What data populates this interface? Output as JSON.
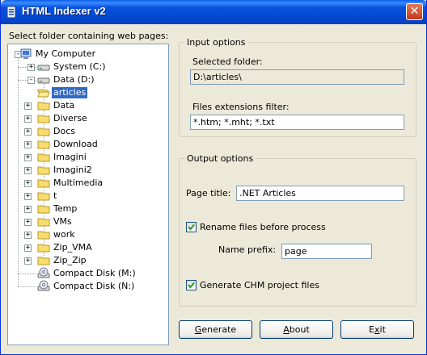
{
  "window": {
    "title": "HTML Indexer v2",
    "close_glyph": "✕"
  },
  "tree": {
    "caption": "Select folder containing web pages:",
    "nodes": [
      {
        "label": "My Computer",
        "icon": "computer-icon"
      },
      {
        "label": "System (C:)",
        "icon": "hard-drive-icon"
      },
      {
        "label": "Data (D:)",
        "icon": "hard-drive-icon"
      },
      {
        "label": "articles",
        "icon": "folder-open-icon",
        "selected": true
      },
      {
        "label": "Data",
        "icon": "folder-icon"
      },
      {
        "label": "Diverse",
        "icon": "folder-icon"
      },
      {
        "label": "Docs",
        "icon": "folder-icon"
      },
      {
        "label": "Download",
        "icon": "folder-icon"
      },
      {
        "label": "Imagini",
        "icon": "folder-icon"
      },
      {
        "label": "Imagini2",
        "icon": "folder-icon"
      },
      {
        "label": "Multimedia",
        "icon": "folder-icon"
      },
      {
        "label": "t",
        "icon": "folder-icon"
      },
      {
        "label": "Temp",
        "icon": "folder-icon"
      },
      {
        "label": "VMs",
        "icon": "folder-icon"
      },
      {
        "label": "work",
        "icon": "folder-icon"
      },
      {
        "label": "Zip_VMA",
        "icon": "folder-icon"
      },
      {
        "label": "Zip_Zip",
        "icon": "folder-icon"
      },
      {
        "label": "Compact Disk (M:)",
        "icon": "cd-drive-icon"
      },
      {
        "label": "Compact Disk (N:)",
        "icon": "cd-drive-icon"
      }
    ]
  },
  "input_options": {
    "legend": "Input options",
    "selected_folder_label": "Selected folder:",
    "selected_folder_value": "D:\\articles\\",
    "extensions_label": "Files extensions filter:",
    "extensions_value": "*.htm; *.mht; *.txt"
  },
  "output_options": {
    "legend": "Output options",
    "page_title_label": "Page title:",
    "page_title_value": ".NET Articles",
    "rename_label": "Rename files before process",
    "rename_checked": true,
    "prefix_label": "Name prefix:",
    "prefix_value": "page",
    "chm_label": "Generate CHM project files",
    "chm_checked": true
  },
  "buttons": {
    "generate_key": "G",
    "generate_rest": "enerate",
    "about_key": "A",
    "about_rest": "bout",
    "exit_pre": "E",
    "exit_key": "x",
    "exit_rest": "it"
  }
}
